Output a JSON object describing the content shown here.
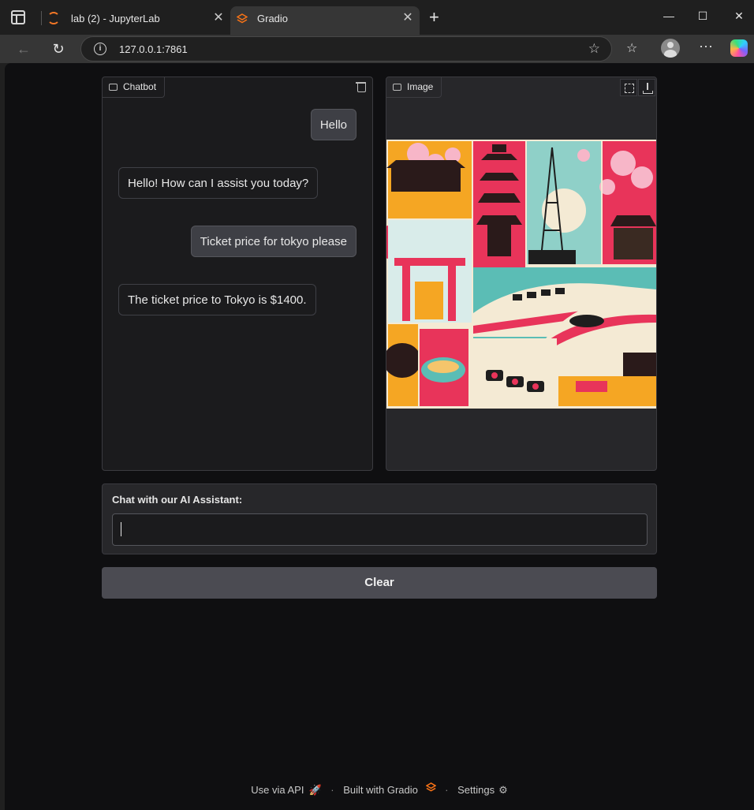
{
  "browser": {
    "tabs": [
      {
        "title": "lab (2) - JupyterLab",
        "active": false
      },
      {
        "title": "Gradio",
        "active": true
      }
    ],
    "url": "127.0.0.1:7861"
  },
  "chatbot": {
    "label": "Chatbot",
    "messages": [
      {
        "role": "user",
        "text": "Hello"
      },
      {
        "role": "bot",
        "text": "Hello! How can I assist you today?"
      },
      {
        "role": "user",
        "text": "Ticket price for tokyo please"
      },
      {
        "role": "bot",
        "text": "The ticket price to Tokyo is $1400."
      }
    ]
  },
  "image": {
    "label": "Image"
  },
  "input": {
    "label": "Chat with our AI Assistant:",
    "value": ""
  },
  "clear_button": "Clear",
  "footer": {
    "api": "Use via API",
    "built": "Built with Gradio",
    "settings": "Settings"
  },
  "colors": {
    "accent_orange": "#f97316",
    "background": "#0f0f11",
    "panel": "#1b1b1d"
  }
}
